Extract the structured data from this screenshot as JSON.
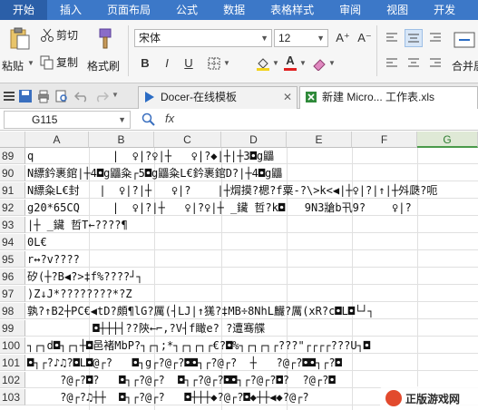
{
  "menu": [
    "开始",
    "插入",
    "页面布局",
    "公式",
    "数据",
    "表格样式",
    "审阅",
    "视图",
    "开发"
  ],
  "ribbon": {
    "paste": "粘贴",
    "cut": "剪切",
    "copy": "复制",
    "format_painter": "格式刷",
    "font_name": "宋体",
    "font_size": "12",
    "bold": "B",
    "italic": "I",
    "underline": "U",
    "grow_font": "A⁺",
    "shrink_font": "A⁻",
    "merge_center": "合并居中"
  },
  "doc_tabs": [
    {
      "label": "Docer-在线模板"
    },
    {
      "label": "新建 Micro... 工作表.xls"
    }
  ],
  "formula_bar": {
    "name_box": "G115",
    "fx": "fx",
    "value": ""
  },
  "columns": [
    "A",
    "B",
    "C",
    "D",
    "E",
    "F",
    "G"
  ],
  "selected_column": "G",
  "rows": [
    {
      "num": "89",
      "text": "q            |  ♀|?♀|┼   ♀|?◆|┼|┼3◘g鼺"
    },
    {
      "num": "90",
      "text": "N縹鈐裹錧|┼4◘g鼺粂┌5◘g鼺粂L€鈐裹錧D?|┼4◘g鼺"
    },
    {
      "num": "91",
      "text": "N縹粂L€封   |  ♀|?|┼   ♀|?    |┼焨摸?楒?f粟-?\\>k<◀|┼♀|?|↑|┼斘瓞?呃"
    },
    {
      "num": "92",
      "text": "g20*65CQ     |  ♀|?|┼   ♀|?♀|┼ _鑶 哲?k◘   9N3牄b卂9?    ♀|?"
    },
    {
      "num": "93",
      "text": "|┼ _鑶 哲T←????¶"
    },
    {
      "num": "94",
      "text": "0L€"
    },
    {
      "num": "95",
      "text": "r↔?v????"
    },
    {
      "num": "96",
      "text": "矽(┼?B◀?>‡f%????┘┐"
    },
    {
      "num": "97",
      "text": ")Z↓J*????????*?Z"
    },
    {
      "num": "98",
      "text": "孰?↑B2┼PC€◀tD?頗¶lG?厲(┤LJ|↑獇?‡MB÷8NhL麣?厲(xR?c◘L◘└┘┐"
    },
    {
      "num": "99",
      "text": "          ◘┼┼┼┤??陝←⌐,?V┤f瞰e? ?遭骞艓"
    },
    {
      "num": "100",
      "text": "┐┌┐d◘┐┌┐┼◘邑褚MbP?┐┌┐;*┐┌┐┌┐┌€?◘%┐┌┐┌┐┌???\"┌┌┌┌???U┐◘"
    },
    {
      "num": "101",
      "text": "◘┐┌?♪♫?◘L◘@┌?   ◘┐g┌?@┌?◘◘┐┌?@┌?  ┼   ?@┌?◘◘┐┌?◘"
    },
    {
      "num": "102",
      "text": "     ?@┌?◘?   ◘┐┌?@┌?  ◘┐┌?@┌?◘◘┐┌?@┌?◘?  ?@┌?◘"
    },
    {
      "num": "103",
      "text": "     ?@┌?♫┼┼  ◘┐┌?@┌?   ◘┼┼┼◆?@┌?◘◆┼┼◀◆?@┌?"
    }
  ],
  "watermark": "正版游戏网"
}
